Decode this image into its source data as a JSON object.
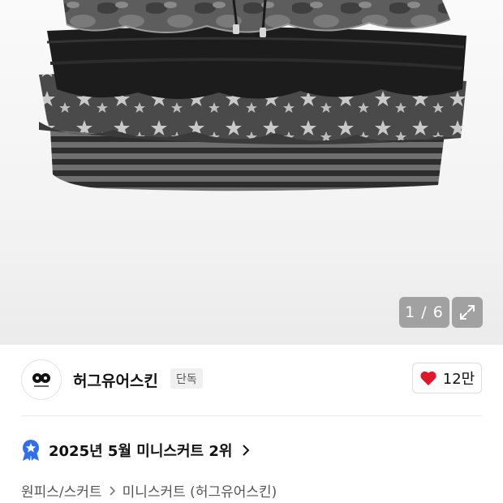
{
  "gallery": {
    "counter_text": "1 / 6"
  },
  "brand": {
    "name": "허그유어스킨",
    "badge": "단독",
    "likes": "12만",
    "heart_color": "#e0162b"
  },
  "ranking": {
    "text": "2025년 5월 미니스커트 2위",
    "badge_color": "#2f6fed"
  },
  "breadcrumb": {
    "items": [
      "원피스/스커트",
      "미니스커트 (허그유어스킨)"
    ]
  }
}
